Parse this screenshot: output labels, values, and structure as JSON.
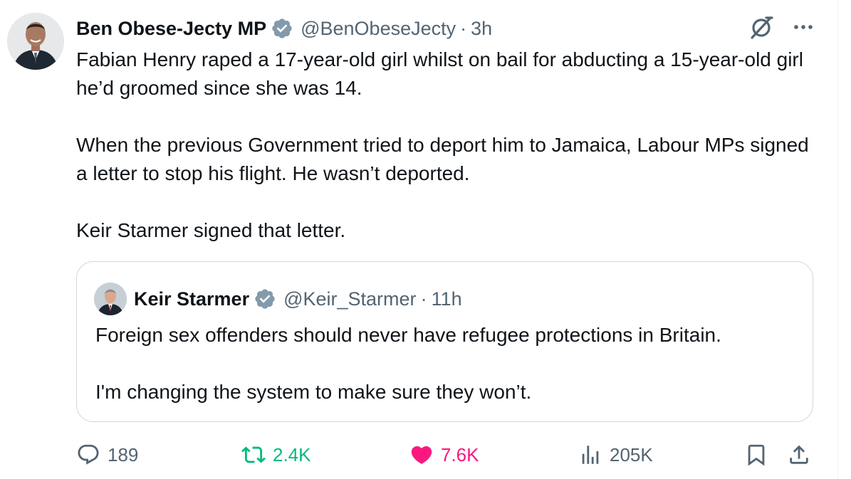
{
  "tweet": {
    "author_name": "Ben Obese-Jecty MP",
    "handle": "@BenObeseJecty",
    "separator": "·",
    "time": "3h",
    "paragraphs": [
      "Fabian Henry raped a 17-year-old girl whilst on bail for abducting a 15-year-old girl he’d groomed since she was 14.",
      "When the previous Government tried to deport him to Jamaica, Labour MPs signed a letter to stop his flight. He wasn’t deported.",
      "Keir Starmer signed that letter."
    ]
  },
  "quoted_tweet": {
    "author_name": "Keir Starmer",
    "handle": "@Keir_Starmer",
    "separator": "·",
    "time": "11h",
    "paragraphs": [
      "Foreign sex offenders should never have refugee protections in Britain.",
      "I'm changing the system to make sure they won’t."
    ]
  },
  "actions": {
    "replies": "189",
    "reposts": "2.4K",
    "likes": "7.6K",
    "views": "205K"
  },
  "colors": {
    "text": "#0f1419",
    "secondary": "#536471",
    "verified": "#829aab",
    "repost": "#00ba7c",
    "like": "#f91880",
    "border": "#cfd9de"
  },
  "icons": [
    "verified-badge-icon",
    "grok-icon",
    "more-icon",
    "reply-icon",
    "repost-icon",
    "like-icon",
    "views-icon",
    "bookmark-icon",
    "share-icon"
  ]
}
